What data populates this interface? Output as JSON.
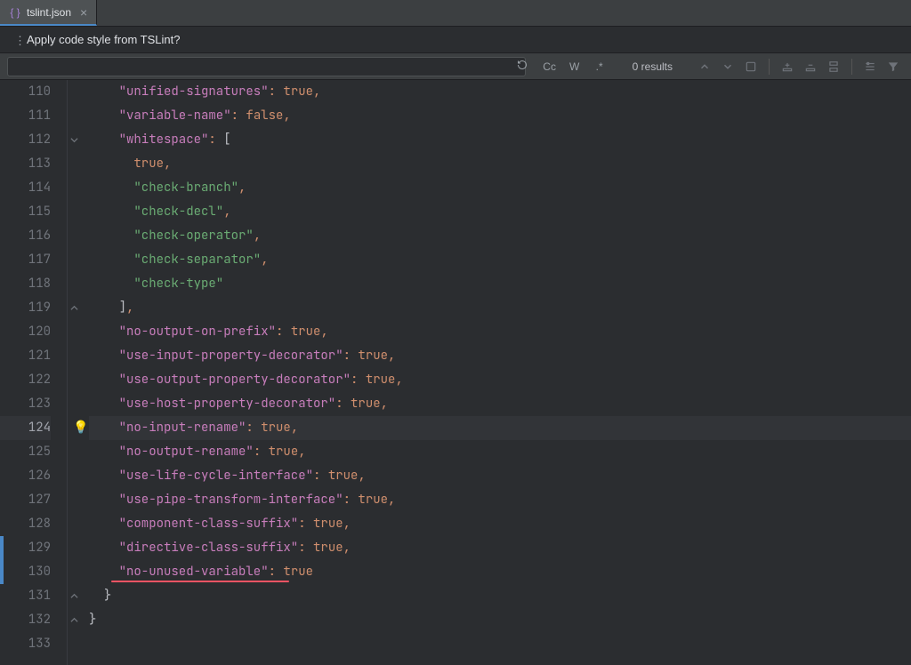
{
  "tab": {
    "filename": "tslint.json",
    "icon_name": "{ }"
  },
  "notice": {
    "text": "Apply code style from TSLint?"
  },
  "find": {
    "placeholder": "",
    "results_text": "0 results",
    "opts": {
      "cc": "Cc",
      "w": "W",
      "regex": ".*"
    }
  },
  "lines": [
    {
      "n": 110,
      "ind": 2,
      "tokens": [
        [
          "key",
          "\"unified-signatures\""
        ],
        [
          "punc",
          ": "
        ],
        [
          "kw",
          "true"
        ],
        [
          "punc",
          ","
        ]
      ]
    },
    {
      "n": 111,
      "ind": 2,
      "tokens": [
        [
          "key",
          "\"variable-name\""
        ],
        [
          "punc",
          ": "
        ],
        [
          "kw",
          "false"
        ],
        [
          "punc",
          ","
        ]
      ]
    },
    {
      "n": 112,
      "ind": 2,
      "fold": "down",
      "tokens": [
        [
          "key",
          "\"whitespace\""
        ],
        [
          "punc",
          ": "
        ],
        [
          "bracket",
          "["
        ]
      ]
    },
    {
      "n": 113,
      "ind": 3,
      "tokens": [
        [
          "kw",
          "true"
        ],
        [
          "punc",
          ","
        ]
      ]
    },
    {
      "n": 114,
      "ind": 3,
      "tokens": [
        [
          "str",
          "\"check-branch\""
        ],
        [
          "punc",
          ","
        ]
      ]
    },
    {
      "n": 115,
      "ind": 3,
      "tokens": [
        [
          "str",
          "\"check-decl\""
        ],
        [
          "punc",
          ","
        ]
      ]
    },
    {
      "n": 116,
      "ind": 3,
      "tokens": [
        [
          "str",
          "\"check-operator\""
        ],
        [
          "punc",
          ","
        ]
      ]
    },
    {
      "n": 117,
      "ind": 3,
      "tokens": [
        [
          "str",
          "\"check-separator\""
        ],
        [
          "punc",
          ","
        ]
      ]
    },
    {
      "n": 118,
      "ind": 3,
      "tokens": [
        [
          "str",
          "\"check-type\""
        ]
      ]
    },
    {
      "n": 119,
      "ind": 2,
      "fold": "up",
      "tokens": [
        [
          "bracket",
          "]"
        ],
        [
          "punc",
          ","
        ]
      ]
    },
    {
      "n": 120,
      "ind": 2,
      "tokens": [
        [
          "key",
          "\"no-output-on-prefix\""
        ],
        [
          "punc",
          ": "
        ],
        [
          "kw",
          "true"
        ],
        [
          "punc",
          ","
        ]
      ]
    },
    {
      "n": 121,
      "ind": 2,
      "tokens": [
        [
          "key",
          "\"use-input-property-decorator\""
        ],
        [
          "punc",
          ": "
        ],
        [
          "kw",
          "true"
        ],
        [
          "punc",
          ","
        ]
      ]
    },
    {
      "n": 122,
      "ind": 2,
      "tokens": [
        [
          "key",
          "\"use-output-property-decorator\""
        ],
        [
          "punc",
          ": "
        ],
        [
          "kw",
          "true"
        ],
        [
          "punc",
          ","
        ]
      ]
    },
    {
      "n": 123,
      "ind": 2,
      "tokens": [
        [
          "key",
          "\"use-host-property-decorator\""
        ],
        [
          "punc",
          ": "
        ],
        [
          "kw",
          "true"
        ],
        [
          "punc",
          ","
        ]
      ]
    },
    {
      "n": 124,
      "ind": 2,
      "current": true,
      "bulb": true,
      "tokens": [
        [
          "key",
          "\"no-input-rename\""
        ],
        [
          "punc",
          ": "
        ],
        [
          "kw",
          "true"
        ],
        [
          "punc",
          ","
        ]
      ]
    },
    {
      "n": 125,
      "ind": 2,
      "tokens": [
        [
          "key",
          "\"no-output-rename\""
        ],
        [
          "punc",
          ": "
        ],
        [
          "kw",
          "true"
        ],
        [
          "punc",
          ","
        ]
      ]
    },
    {
      "n": 126,
      "ind": 2,
      "tokens": [
        [
          "key",
          "\"use-life-cycle-interface\""
        ],
        [
          "punc",
          ": "
        ],
        [
          "kw",
          "true"
        ],
        [
          "punc",
          ","
        ]
      ]
    },
    {
      "n": 127,
      "ind": 2,
      "tokens": [
        [
          "key",
          "\"use-pipe-transform-interface\""
        ],
        [
          "punc",
          ": "
        ],
        [
          "kw",
          "true"
        ],
        [
          "punc",
          ","
        ]
      ]
    },
    {
      "n": 128,
      "ind": 2,
      "tokens": [
        [
          "key",
          "\"component-class-suffix\""
        ],
        [
          "punc",
          ": "
        ],
        [
          "kw",
          "true"
        ],
        [
          "punc",
          ","
        ]
      ]
    },
    {
      "n": 129,
      "ind": 2,
      "changed": true,
      "tokens": [
        [
          "key",
          "\"directive-class-suffix\""
        ],
        [
          "punc",
          ": "
        ],
        [
          "kw",
          "true"
        ],
        [
          "punc",
          ","
        ]
      ]
    },
    {
      "n": 130,
      "ind": 2,
      "changed": true,
      "underline": true,
      "tokens": [
        [
          "key",
          "\"no-unused-variable\""
        ],
        [
          "punc",
          ": "
        ],
        [
          "kw",
          "true"
        ]
      ]
    },
    {
      "n": 131,
      "ind": 1,
      "fold": "up",
      "tokens": [
        [
          "bracket",
          "}"
        ]
      ]
    },
    {
      "n": 132,
      "ind": 0,
      "fold": "up",
      "tokens": [
        [
          "bracket",
          "}"
        ]
      ]
    },
    {
      "n": 133,
      "ind": 0,
      "tokens": []
    }
  ]
}
